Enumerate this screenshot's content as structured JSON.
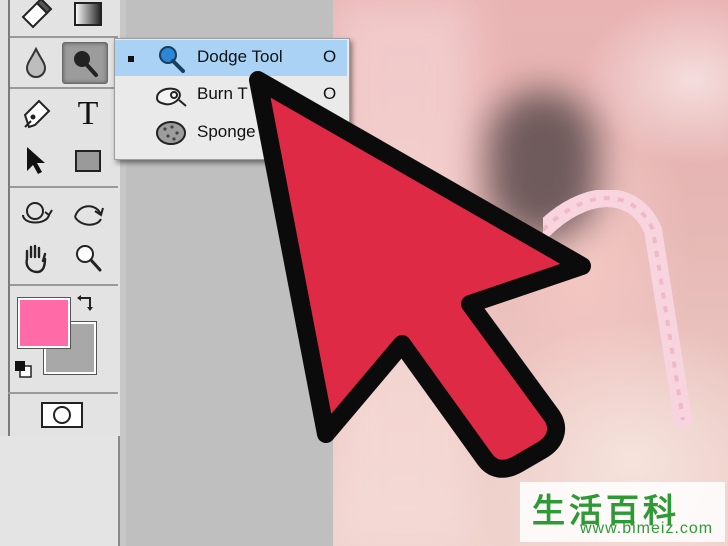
{
  "flyout_menu": {
    "items": [
      {
        "label": "Dodge Tool",
        "shortcut": "O",
        "selected": true,
        "icon": "dodge-icon"
      },
      {
        "label": "Burn T",
        "shortcut": "O",
        "selected": false,
        "icon": "burn-icon"
      },
      {
        "label": "Sponge",
        "shortcut": "",
        "selected": false,
        "icon": "sponge-icon"
      }
    ]
  },
  "toolbar": {
    "tools": [
      "eraser-icon",
      "gradient-icon",
      "blur-icon",
      "dodge-icon",
      "pen-icon",
      "type-icon",
      "path-selection-icon",
      "rectangle-icon",
      "3d-rotate-icon",
      "3d-roll-icon",
      "hand-icon",
      "zoom-icon"
    ],
    "type_tool_glyph": "T"
  },
  "colors": {
    "foreground": "#ff6aa7",
    "background": "#a8a8a8",
    "menu_highlight": "#a9d2f4",
    "arrow_fill": "#de2a45"
  },
  "watermark": {
    "chinese": "生活百科",
    "url": "www.bimeiz.com"
  }
}
